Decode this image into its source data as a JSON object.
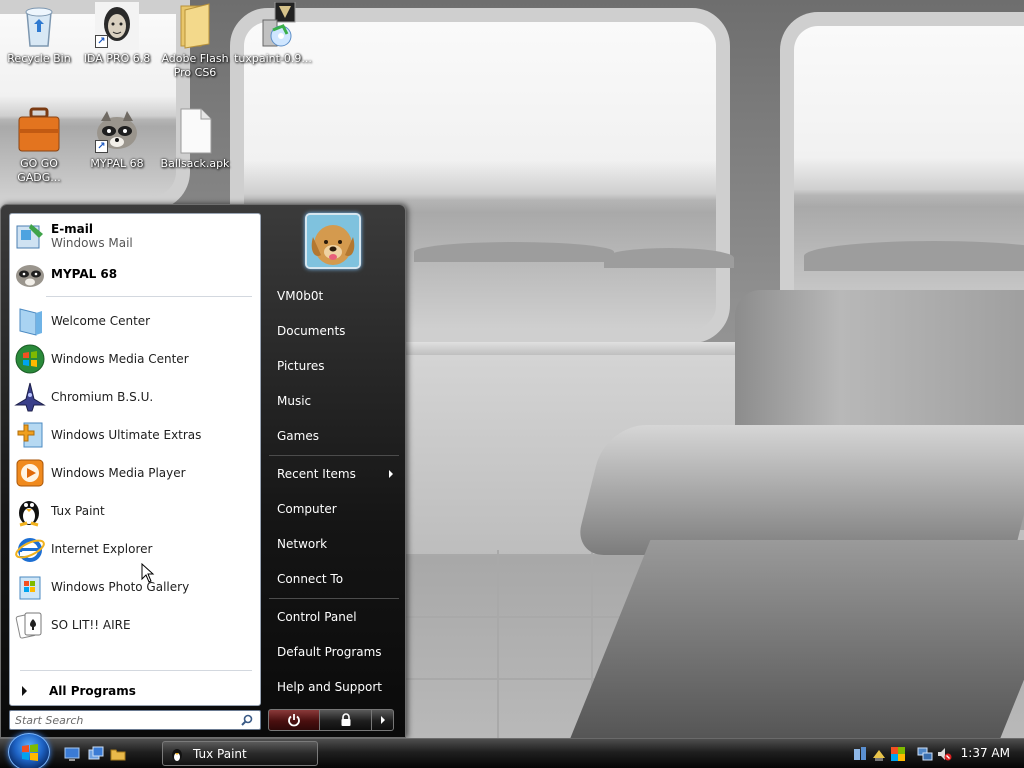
{
  "desktop": {
    "icons": [
      {
        "label": "Recycle Bin"
      },
      {
        "label": "IDA PRO 6.8"
      },
      {
        "label": "Adobe Flash Pro CS6"
      },
      {
        "label": "tuxpaint-0.9..."
      },
      {
        "label": "GO GO GADG..."
      },
      {
        "label": "MYPAL 68"
      },
      {
        "label": "Ballsack.apk"
      }
    ]
  },
  "start_menu": {
    "pinned": [
      {
        "title": "E-mail",
        "subtitle": "Windows Mail",
        "icon": "windows-mail-icon"
      },
      {
        "title": "MYPAL 68",
        "subtitle": "",
        "icon": "mypal-icon"
      }
    ],
    "programs": [
      {
        "label": "Welcome Center",
        "icon": "welcome-center-icon"
      },
      {
        "label": "Windows Media Center",
        "icon": "media-center-icon"
      },
      {
        "label": "Chromium B.S.U.",
        "icon": "chromium-bsu-icon"
      },
      {
        "label": "Windows Ultimate Extras",
        "icon": "ultimate-extras-icon"
      },
      {
        "label": "Windows Media Player",
        "icon": "media-player-icon"
      },
      {
        "label": "Tux Paint",
        "icon": "tux-paint-icon"
      },
      {
        "label": "Internet Explorer",
        "icon": "internet-explorer-icon"
      },
      {
        "label": "Windows Photo Gallery",
        "icon": "photo-gallery-icon"
      },
      {
        "label": "SO LIT!! AIRE",
        "icon": "solitaire-icon"
      }
    ],
    "all_programs_label": "All Programs",
    "search_placeholder": "Start Search",
    "right_items": [
      {
        "label": "VM0b0t"
      },
      {
        "label": "Documents"
      },
      {
        "label": "Pictures"
      },
      {
        "label": "Music"
      },
      {
        "label": "Games"
      },
      {
        "label": "Recent Items"
      },
      {
        "label": "Computer"
      },
      {
        "label": "Network"
      },
      {
        "label": "Connect To"
      },
      {
        "label": "Control Panel"
      },
      {
        "label": "Default Programs"
      },
      {
        "label": "Help and Support"
      }
    ]
  },
  "taskbar": {
    "tasks": [
      {
        "label": "Tux Paint"
      }
    ],
    "clock": "1:37 AM"
  },
  "colors": {
    "start_menu_bg": "#151515",
    "taskbar_bg": "#1f1f1f",
    "orb_blue": "#1e63c5"
  }
}
